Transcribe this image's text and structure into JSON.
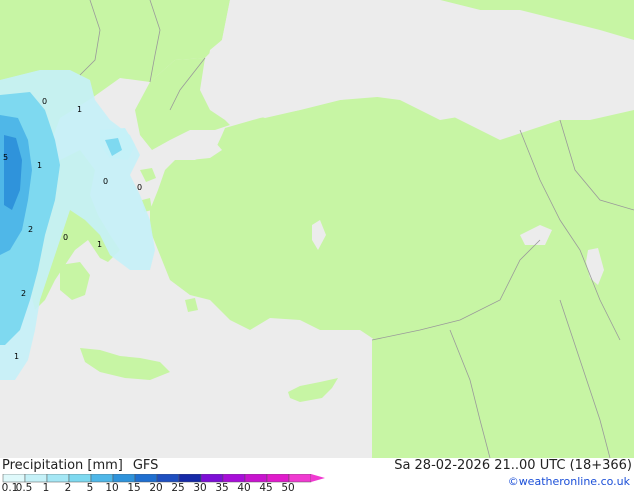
{
  "legend": {
    "title": "Precipitation [mm]",
    "model": "GFS",
    "bins": [
      {
        "label": "0.1",
        "color": "#dff9fb"
      },
      {
        "label": "0.5",
        "color": "#c5f1f8"
      },
      {
        "label": "1",
        "color": "#a5e7f5"
      },
      {
        "label": "2",
        "color": "#7ed9f0"
      },
      {
        "label": "5",
        "color": "#4fb7e8"
      },
      {
        "label": "10",
        "color": "#2f93db"
      },
      {
        "label": "15",
        "color": "#1f6fd0"
      },
      {
        "label": "20",
        "color": "#1e4fc0"
      },
      {
        "label": "25",
        "color": "#162aa8"
      },
      {
        "label": "30",
        "color": "#7d0fd6"
      },
      {
        "label": "35",
        "color": "#a80ed9"
      },
      {
        "label": "40",
        "color": "#c814cf"
      },
      {
        "label": "45",
        "color": "#e01bcb"
      },
      {
        "label": "50",
        "color": "#f03ad1"
      }
    ]
  },
  "valid_time": "Sa 28-02-2026 21..00 UTC (18+366)",
  "credit": "©weatheronline.co.uk",
  "colors": {
    "land": "#c7f5a4",
    "sea": "#ececec",
    "border": "#9a9a9a"
  },
  "map_labels": [
    {
      "text": "0"
    },
    {
      "text": "1"
    },
    {
      "text": "5"
    },
    {
      "text": "1"
    },
    {
      "text": "0"
    },
    {
      "text": "0"
    },
    {
      "text": "2"
    },
    {
      "text": "0"
    },
    {
      "text": "1"
    },
    {
      "text": "2"
    },
    {
      "text": "1"
    }
  ]
}
